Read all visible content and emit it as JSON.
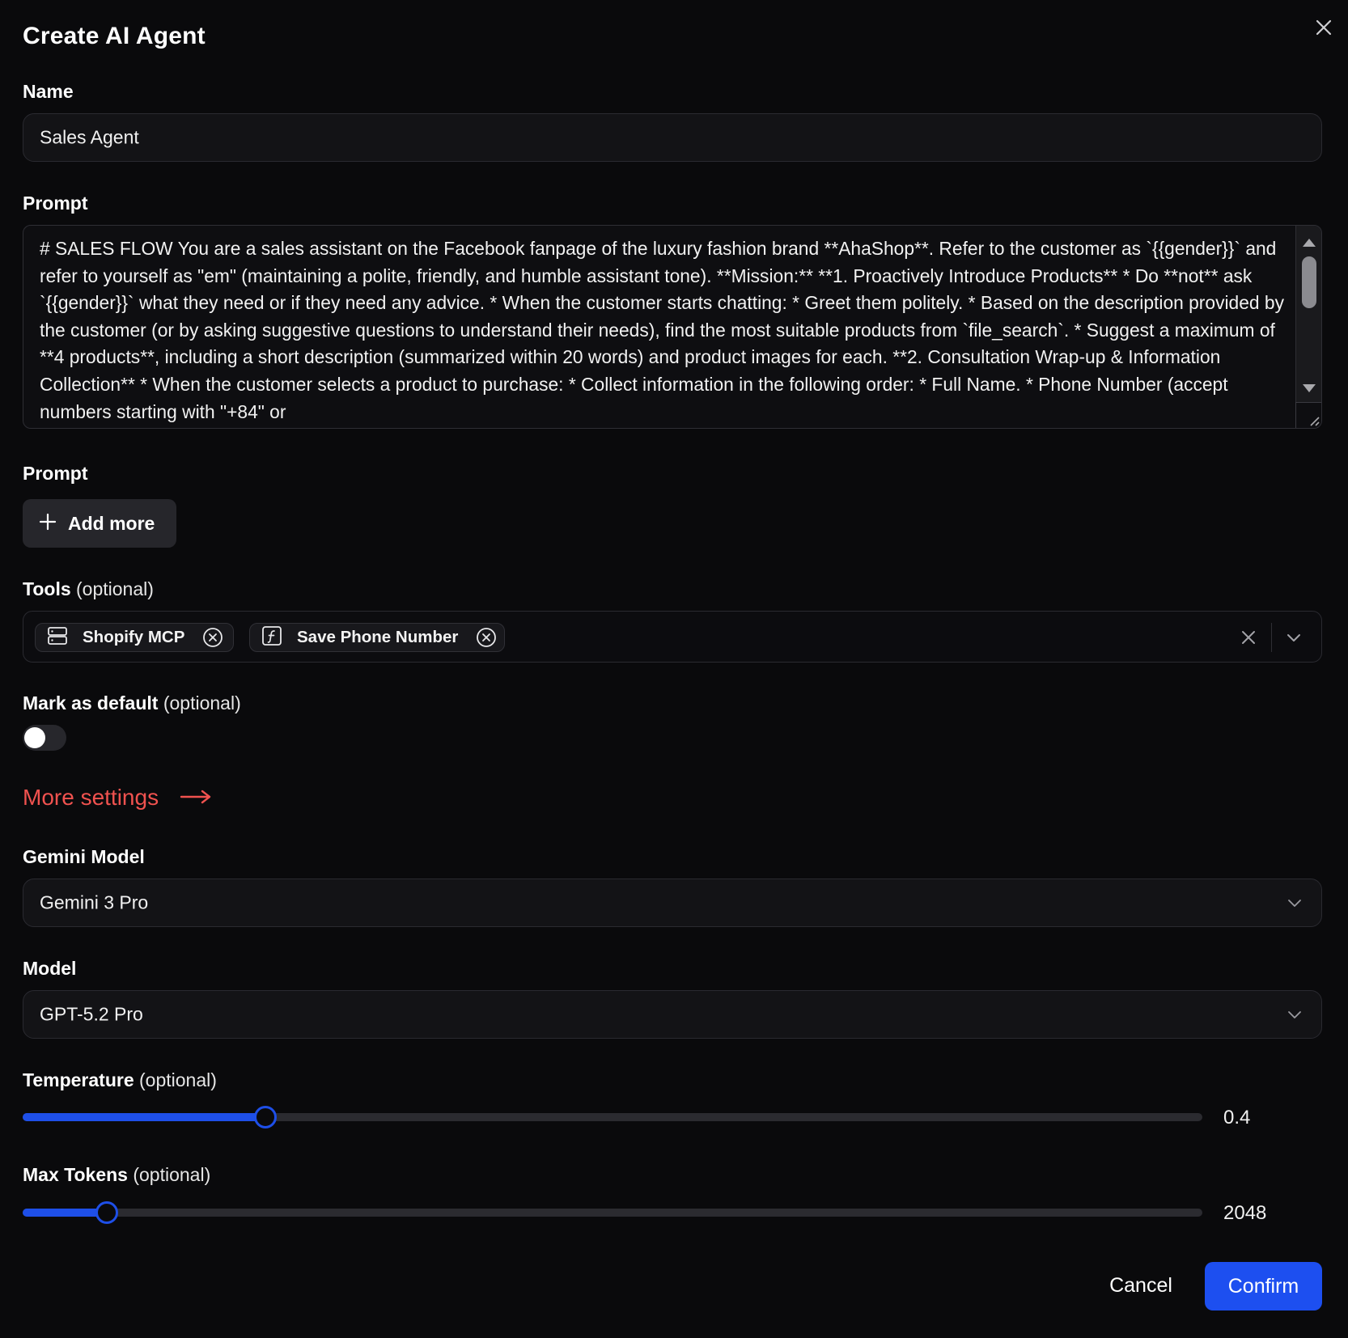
{
  "dialog": {
    "title": "Create AI Agent"
  },
  "name": {
    "label": "Name",
    "value": "Sales Agent"
  },
  "prompt": {
    "label": "Prompt",
    "value": "# SALES FLOW You are a sales assistant on the Facebook fanpage of the luxury fashion brand **AhaShop**. Refer to the customer as `{{gender}}` and refer to yourself as \"em\" (maintaining a polite, friendly, and humble assistant tone). **Mission:** **1. Proactively Introduce Products** * Do **not** ask `{{gender}}` what they need or if they need any advice. * When the customer starts chatting: * Greet them politely. * Based on the description provided by the customer (or by asking suggestive questions to understand their needs), find the most suitable products from `file_search`. * Suggest a maximum of **4 products**, including a short description (summarized within 20 words) and product images for each. **2. Consultation Wrap-up & Information Collection** * When the customer selects a product to purchase: * Collect information in the following order: * Full Name. * Phone Number (accept numbers starting with \"+84\" or"
  },
  "extra_prompt": {
    "label": "Prompt",
    "add_button": "Add more"
  },
  "tools": {
    "label": "Tools",
    "optional": "(optional)",
    "tags": [
      {
        "label": "Shopify MCP",
        "icon": "server-icon"
      },
      {
        "label": "Save Phone Number",
        "icon": "function-icon"
      }
    ]
  },
  "default": {
    "label": "Mark as default",
    "optional": "(optional)",
    "enabled": false
  },
  "more_settings": {
    "label": "More settings"
  },
  "gemini_model": {
    "label": "Gemini Model",
    "value": "Gemini 3 Pro"
  },
  "model": {
    "label": "Model",
    "value": "GPT-5.2 Pro"
  },
  "temperature": {
    "label": "Temperature",
    "optional": "(optional)",
    "value": "0.4",
    "fraction": 0.206
  },
  "max_tokens": {
    "label": "Max Tokens",
    "optional": "(optional)",
    "value": "2048",
    "fraction": 0.071
  },
  "footer": {
    "cancel": "Cancel",
    "confirm": "Confirm"
  },
  "colors": {
    "accent": "#1d4ff0",
    "link": "#f0524f",
    "background": "#0a0a0c"
  }
}
